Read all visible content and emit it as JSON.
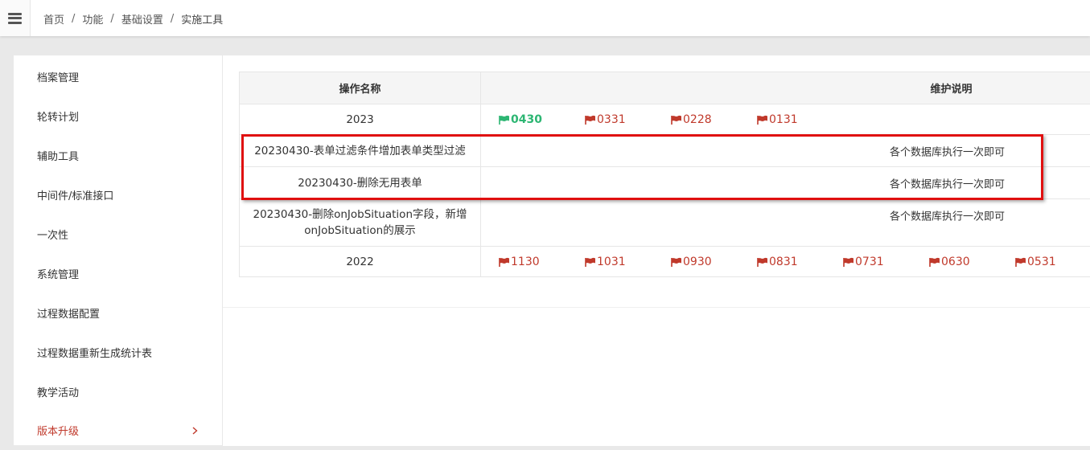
{
  "breadcrumb": [
    "首页",
    "功能",
    "基础设置",
    "实施工具"
  ],
  "sidebar": {
    "items": [
      {
        "label": "档案管理"
      },
      {
        "label": "轮转计划"
      },
      {
        "label": "辅助工具"
      },
      {
        "label": "中间件/标准接口"
      },
      {
        "label": "一次性"
      },
      {
        "label": "系统管理"
      },
      {
        "label": "过程数据配置"
      },
      {
        "label": "过程数据重新生成统计表"
      },
      {
        "label": "教学活动"
      },
      {
        "label": "版本升级"
      }
    ]
  },
  "table": {
    "headers": {
      "name": "操作名称",
      "desc": "维护说明"
    },
    "rows": [
      {
        "name": "2023",
        "flags": [
          "0430",
          "0331",
          "0228",
          "0131"
        ],
        "current_flag": "0430"
      },
      {
        "name": "20230430-表单过滤条件增加表单类型过滤",
        "desc": "各个数据库执行一次即可"
      },
      {
        "name": "20230430-删除无用表单",
        "desc": "各个数据库执行一次即可"
      },
      {
        "name_line1": "20230430-删除onJobSituation字段，新增",
        "name_line2": "onJobSituation的展示",
        "desc": "各个数据库执行一次即可"
      },
      {
        "name": "2022",
        "flags": [
          "1130",
          "1031",
          "0930",
          "0831",
          "0731",
          "0630",
          "0531"
        ]
      }
    ]
  },
  "colors": {
    "accent_red": "#c0392b",
    "current_green": "#2db673",
    "highlight_box": "#e01010"
  }
}
